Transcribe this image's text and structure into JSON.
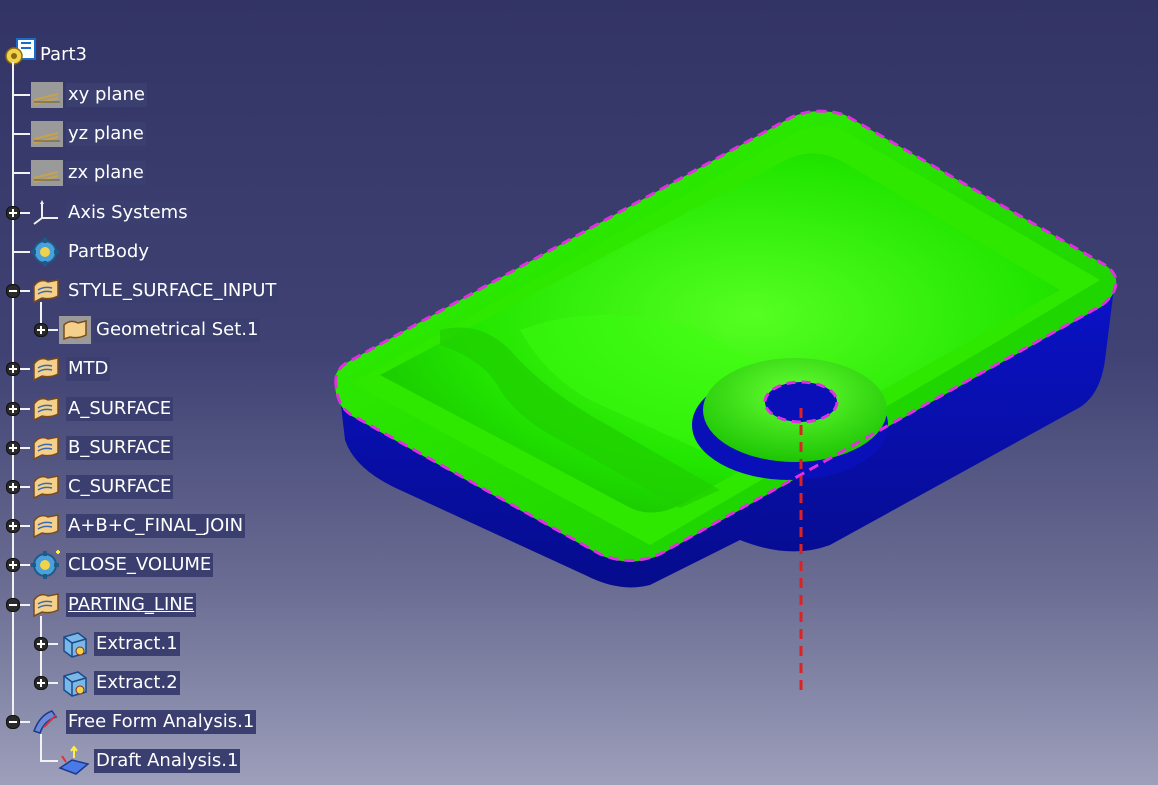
{
  "tree": {
    "root": {
      "label": "Part3",
      "icon": "part-gear-icon"
    },
    "items": [
      {
        "label": "xy plane",
        "icon": "plane-icon",
        "expander": "none",
        "level": 1
      },
      {
        "label": "yz plane",
        "icon": "plane-icon",
        "expander": "none",
        "level": 1
      },
      {
        "label": "zx plane",
        "icon": "plane-icon",
        "expander": "none",
        "level": 1
      },
      {
        "label": "Axis Systems",
        "icon": "axis-system-icon",
        "expander": "plus",
        "level": 1
      },
      {
        "label": "PartBody",
        "icon": "part-body-gear-icon",
        "expander": "none",
        "level": 1
      },
      {
        "label": "STYLE_SURFACE_INPUT",
        "icon": "geometrical-set-icon",
        "expander": "minus",
        "level": 1
      },
      {
        "label": "Geometrical Set.1",
        "icon": "geometrical-set-boxed-icon",
        "expander": "plus",
        "level": 2
      },
      {
        "label": "MTD",
        "icon": "geometrical-set-icon",
        "expander": "plus",
        "level": 1
      },
      {
        "label": "A_SURFACE",
        "icon": "geometrical-set-icon",
        "expander": "plus",
        "level": 1
      },
      {
        "label": "B_SURFACE",
        "icon": "geometrical-set-icon",
        "expander": "plus",
        "level": 1
      },
      {
        "label": "C_SURFACE",
        "icon": "geometrical-set-icon",
        "expander": "plus",
        "level": 1
      },
      {
        "label": "A+B+C_FINAL_JOIN",
        "icon": "geometrical-set-icon",
        "expander": "plus",
        "level": 1
      },
      {
        "label": "CLOSE_VOLUME",
        "icon": "body-gear-icon",
        "expander": "plus",
        "level": 1
      },
      {
        "label": "PARTING_LINE",
        "icon": "geometrical-set-icon",
        "expander": "minus",
        "level": 1,
        "underlined": true
      },
      {
        "label": "Extract.1",
        "icon": "extract-icon",
        "expander": "plus",
        "level": 2
      },
      {
        "label": "Extract.2",
        "icon": "extract-icon",
        "expander": "plus",
        "level": 2
      },
      {
        "label": "Free Form Analysis.1",
        "icon": "free-form-analysis-icon",
        "expander": "minus",
        "level": 1
      },
      {
        "label": "Draft Analysis.1",
        "icon": "draft-analysis-icon",
        "expander": "none",
        "level": 2
      }
    ]
  },
  "model": {
    "name": "tray-part-3d-model",
    "colors": {
      "inner_surface": "#22ee00",
      "outer_surface": "#0a10b8",
      "parting_line": "#e030e0",
      "pull_direction": "#dd2222",
      "tree_label_bg": "#3b3f70"
    }
  }
}
